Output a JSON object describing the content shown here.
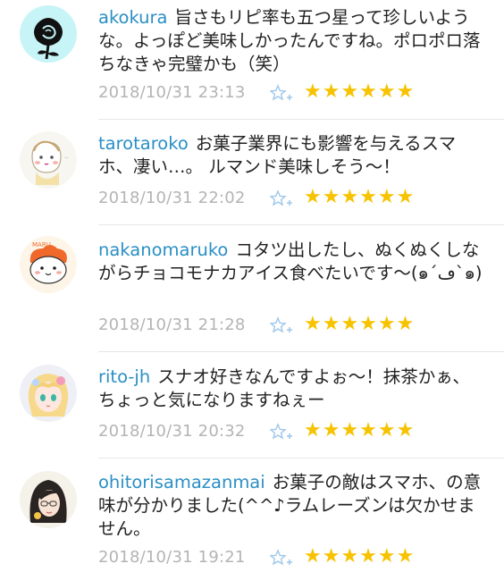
{
  "comments": [
    {
      "user": "akokura",
      "text": "旨さもリピ率も五つ星って珍しいような。よっぽど美味しかったんですね。ポロポロ落ちなきゃ完璧かも（笑）",
      "timestamp": "2018/10/31 23:13",
      "stars": "★★★★★★",
      "avatar": "black-rose-icon"
    },
    {
      "user": "tarotaroko",
      "text": "お菓子業界にも影響を与えるスマホ、凄い…。 ルマンド美味しそう～！",
      "timestamp": "2018/10/31 22:02",
      "stars": "★★★★★★",
      "avatar": "baby-drawing-icon"
    },
    {
      "user": "nakanomaruko",
      "text": "コタツ出したし、ぬくぬくしながらチョコモナカアイス食べたいです～(๑´ڡ`๑)",
      "timestamp": "2018/10/31 21:28",
      "stars": "★★★★★★",
      "avatar": "maru-character-icon"
    },
    {
      "user": "rito-jh",
      "text": "スナオ好きなんですよぉ～！抹茶かぁ、ちょっと気になりますねぇー",
      "timestamp": "2018/10/31 20:32",
      "stars": "★★★★★★",
      "avatar": "anime-girl-icon"
    },
    {
      "user": "ohitorisamazanmai",
      "text": "お菓子の敵はスマホ、の意味が分かりました(^^♪ラムレーズンは欠かせません。",
      "timestamp": "2018/10/31 19:21",
      "stars": "★★★★★★",
      "avatar": "woman-glasses-icon"
    }
  ],
  "colors": {
    "username": "#2a8fc5",
    "timestamp": "#b4b4b4",
    "star": "#f7c300",
    "fav_icon": "#9fc7ea"
  }
}
